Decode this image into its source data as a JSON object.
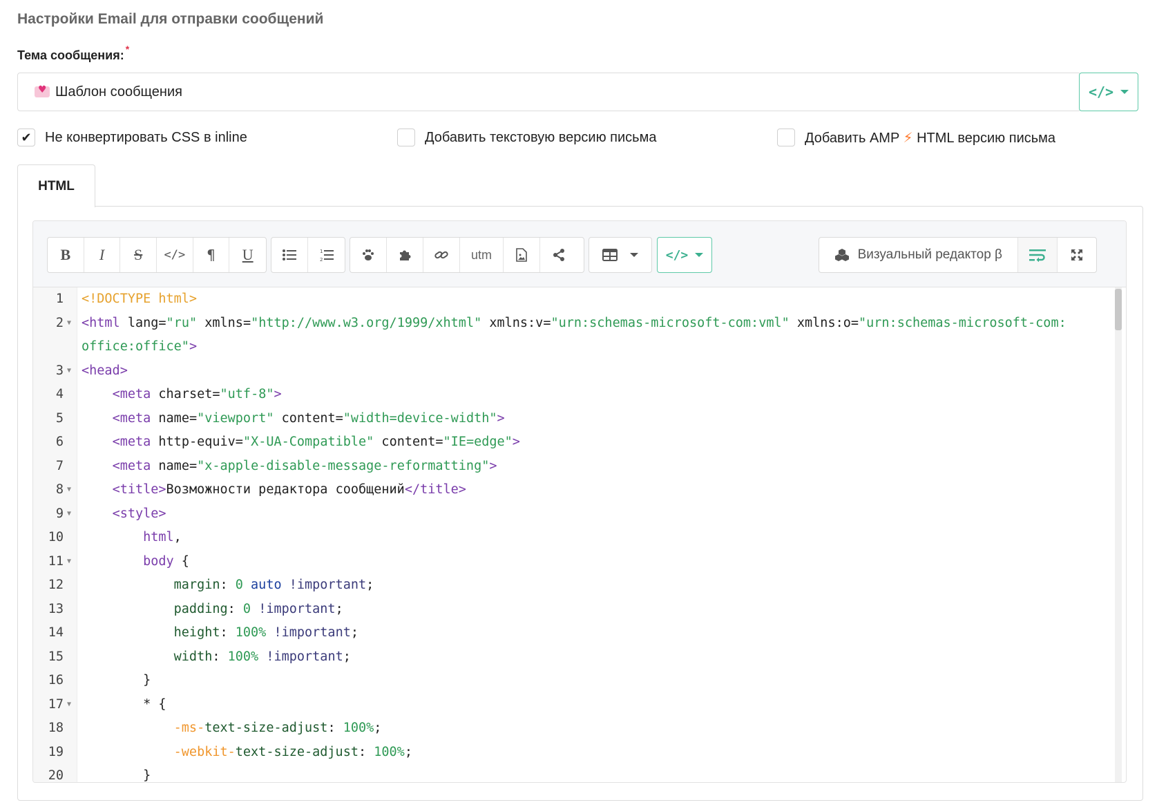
{
  "section_title": "Настройки Email для отправки сообщений",
  "subject": {
    "label": "Тема сообщения:",
    "required_mark": "*",
    "value": "Шаблон сообщения",
    "value_icon": "heart-letter-icon",
    "insert_variable_icon": "code-brackets-icon"
  },
  "options": [
    {
      "label": "Не конвертировать CSS в inline",
      "checked": true
    },
    {
      "label": "Добавить текстовую версию письма",
      "checked": false
    },
    {
      "label_before": "Добавить AMP",
      "label_after": "HTML версию письма",
      "icon": "lightning-icon",
      "checked": false
    }
  ],
  "tabs": [
    {
      "label": "HTML",
      "active": true
    }
  ],
  "toolbar": {
    "format_buttons": [
      "bold-icon",
      "italic-icon",
      "strikethrough-icon",
      "code-icon",
      "paragraph-icon",
      "underline-icon"
    ],
    "list_buttons": [
      "bullet-list-icon",
      "numbered-list-icon"
    ],
    "insert_buttons": [
      "paw-icon",
      "puzzle-icon",
      "link-icon",
      "utm",
      "image-file-icon",
      "share-icon"
    ],
    "utm_label": "utm",
    "table_button": "table-icon",
    "code_variable_button": "code-brackets-icon",
    "visual_editor_label": "Визуальный редактор β",
    "wrap_button": "wrap-lines-icon",
    "fullscreen_button": "fullscreen-icon"
  },
  "code_lines": [
    {
      "n": "1",
      "fold": false,
      "text": "<!DOCTYPE html>"
    },
    {
      "n": "2",
      "fold": true,
      "text": "<html lang=\"ru\" xmlns=\"http://www.w3.org/1999/xhtml\" xmlns:v=\"urn:schemas-microsoft-com:vml\" xmlns:o=\"urn:schemas-microsoft-com:office:office\">"
    },
    {
      "n": "3",
      "fold": true,
      "text": "<head>"
    },
    {
      "n": "4",
      "fold": false,
      "text": "    <meta charset=\"utf-8\">"
    },
    {
      "n": "5",
      "fold": false,
      "text": "    <meta name=\"viewport\" content=\"width=device-width\">"
    },
    {
      "n": "6",
      "fold": false,
      "text": "    <meta http-equiv=\"X-UA-Compatible\" content=\"IE=edge\">"
    },
    {
      "n": "7",
      "fold": false,
      "text": "    <meta name=\"x-apple-disable-message-reformatting\">"
    },
    {
      "n": "8",
      "fold": true,
      "text": "    <title>Возможности редактора сообщений</title>"
    },
    {
      "n": "9",
      "fold": true,
      "text": "    <style>"
    },
    {
      "n": "10",
      "fold": false,
      "text": "        html,"
    },
    {
      "n": "11",
      "fold": true,
      "text": "        body {"
    },
    {
      "n": "12",
      "fold": false,
      "text": "            margin: 0 auto !important;"
    },
    {
      "n": "13",
      "fold": false,
      "text": "            padding: 0 !important;"
    },
    {
      "n": "14",
      "fold": false,
      "text": "            height: 100% !important;"
    },
    {
      "n": "15",
      "fold": false,
      "text": "            width: 100% !important;"
    },
    {
      "n": "16",
      "fold": false,
      "text": "        }"
    },
    {
      "n": "17",
      "fold": true,
      "text": "        * {"
    },
    {
      "n": "18",
      "fold": false,
      "text": "            -ms-text-size-adjust: 100%;"
    },
    {
      "n": "19",
      "fold": false,
      "text": "            -webkit-text-size-adjust: 100%;"
    },
    {
      "n": "20",
      "fold": false,
      "text": "        }"
    }
  ]
}
